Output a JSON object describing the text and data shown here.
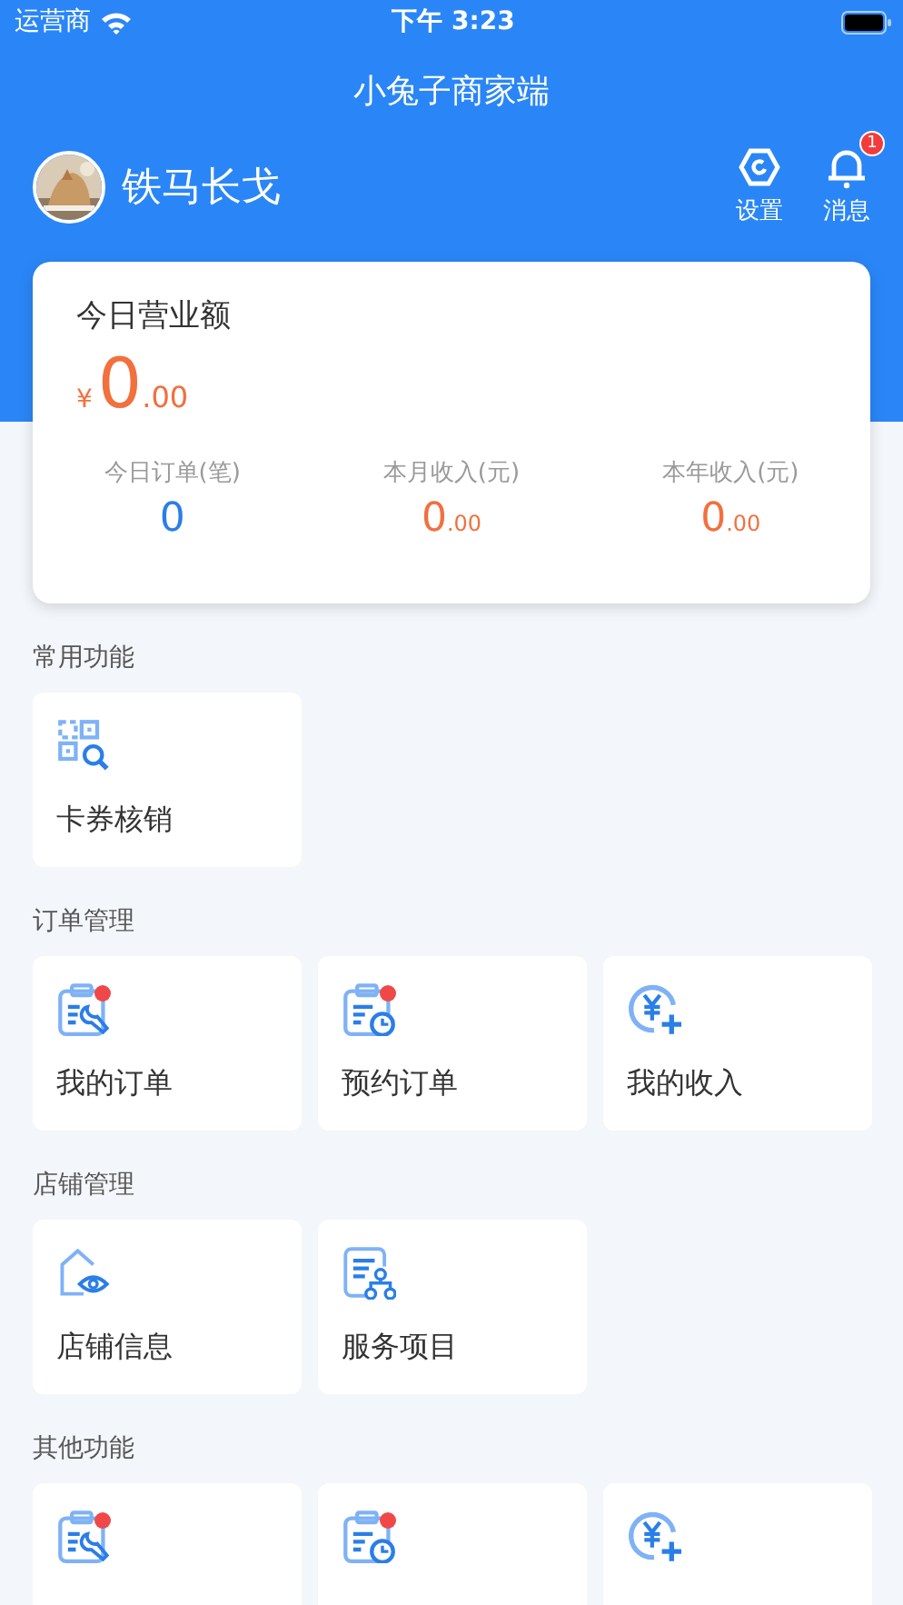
{
  "status_bar": {
    "carrier": "运营商",
    "time": "下午 3:23"
  },
  "header": {
    "title": "小兔子商家端",
    "user_name": "铁马长戈",
    "actions": [
      {
        "kind": "settings",
        "label": "设置"
      },
      {
        "kind": "bell",
        "label": "消息",
        "badge": "1"
      }
    ]
  },
  "summary": {
    "title": "今日营业额",
    "currency": "¥",
    "amount_int": "0",
    "amount_dec": ".00",
    "stats": [
      {
        "label": "今日订单(笔)",
        "value_int": "0",
        "kind": "count"
      },
      {
        "label": "本月收入(元)",
        "value_int": "0",
        "value_dec": ".00",
        "kind": "money"
      },
      {
        "label": "本年收入(元)",
        "value_int": "0",
        "value_dec": ".00",
        "kind": "money"
      }
    ]
  },
  "sections": [
    {
      "title": "常用功能",
      "items": [
        {
          "label": "卡券核销",
          "kind": "coupon",
          "dot": false
        }
      ]
    },
    {
      "title": "订单管理",
      "items": [
        {
          "label": "我的订单",
          "kind": "order",
          "dot": true
        },
        {
          "label": "预约订单",
          "kind": "booking",
          "dot": true
        },
        {
          "label": "我的收入",
          "kind": "income",
          "dot": false
        }
      ]
    },
    {
      "title": "店铺管理",
      "items": [
        {
          "label": "店铺信息",
          "kind": "shop",
          "dot": false
        },
        {
          "label": "服务项目",
          "kind": "service",
          "dot": false
        }
      ]
    },
    {
      "title": "其他功能",
      "items": [
        {
          "kind": "order",
          "dot": true
        },
        {
          "kind": "booking",
          "dot": true
        },
        {
          "kind": "income",
          "dot": false
        }
      ]
    }
  ]
}
